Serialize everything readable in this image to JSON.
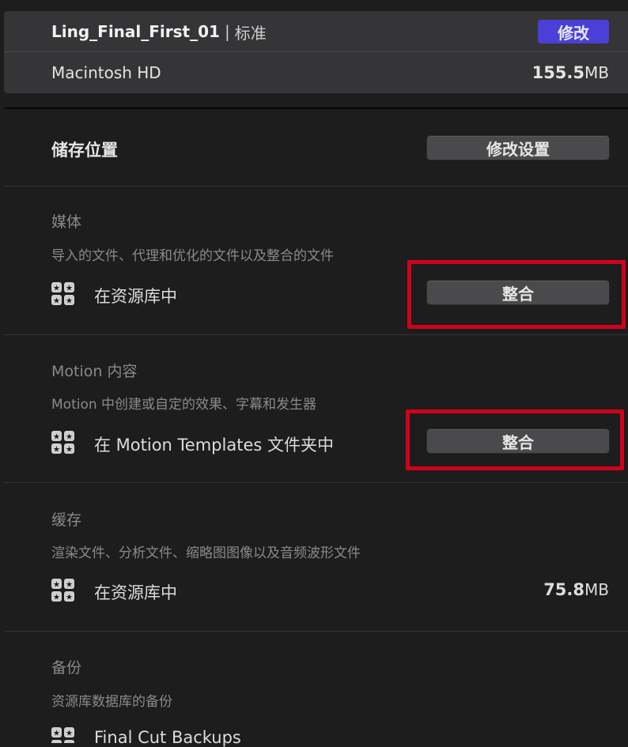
{
  "header": {
    "library_name": "Ling_Final_First_01",
    "separator": "|",
    "library_type": "标准",
    "modify_label": "修改",
    "volume": "Macintosh HD",
    "size_value": "155.5",
    "size_unit": "MB"
  },
  "storage": {
    "title": "储存位置",
    "modify_settings_label": "修改设置"
  },
  "sections": {
    "media": {
      "title": "媒体",
      "description": "导入的文件、代理和优化的文件以及整合的文件",
      "location": "在资源库中",
      "button_label": "整合"
    },
    "motion": {
      "title": "Motion 内容",
      "description": "Motion 中创建或自定的效果、字幕和发生器",
      "location": "在 Motion Templates 文件夹中",
      "button_label": "整合"
    },
    "cache": {
      "title": "缓存",
      "description": "渲染文件、分析文件、缩略图图像以及音频波形文件",
      "location": "在资源库中",
      "size_value": "75.8",
      "size_unit": "MB"
    },
    "backup": {
      "title": "备份",
      "description": "资源库数据库的备份",
      "location": "Final Cut Backups"
    }
  },
  "colors": {
    "highlight": "#d0021b",
    "accent_button": "#4a3fd6"
  },
  "icons": {
    "library_icon": "library-grid-icon"
  }
}
